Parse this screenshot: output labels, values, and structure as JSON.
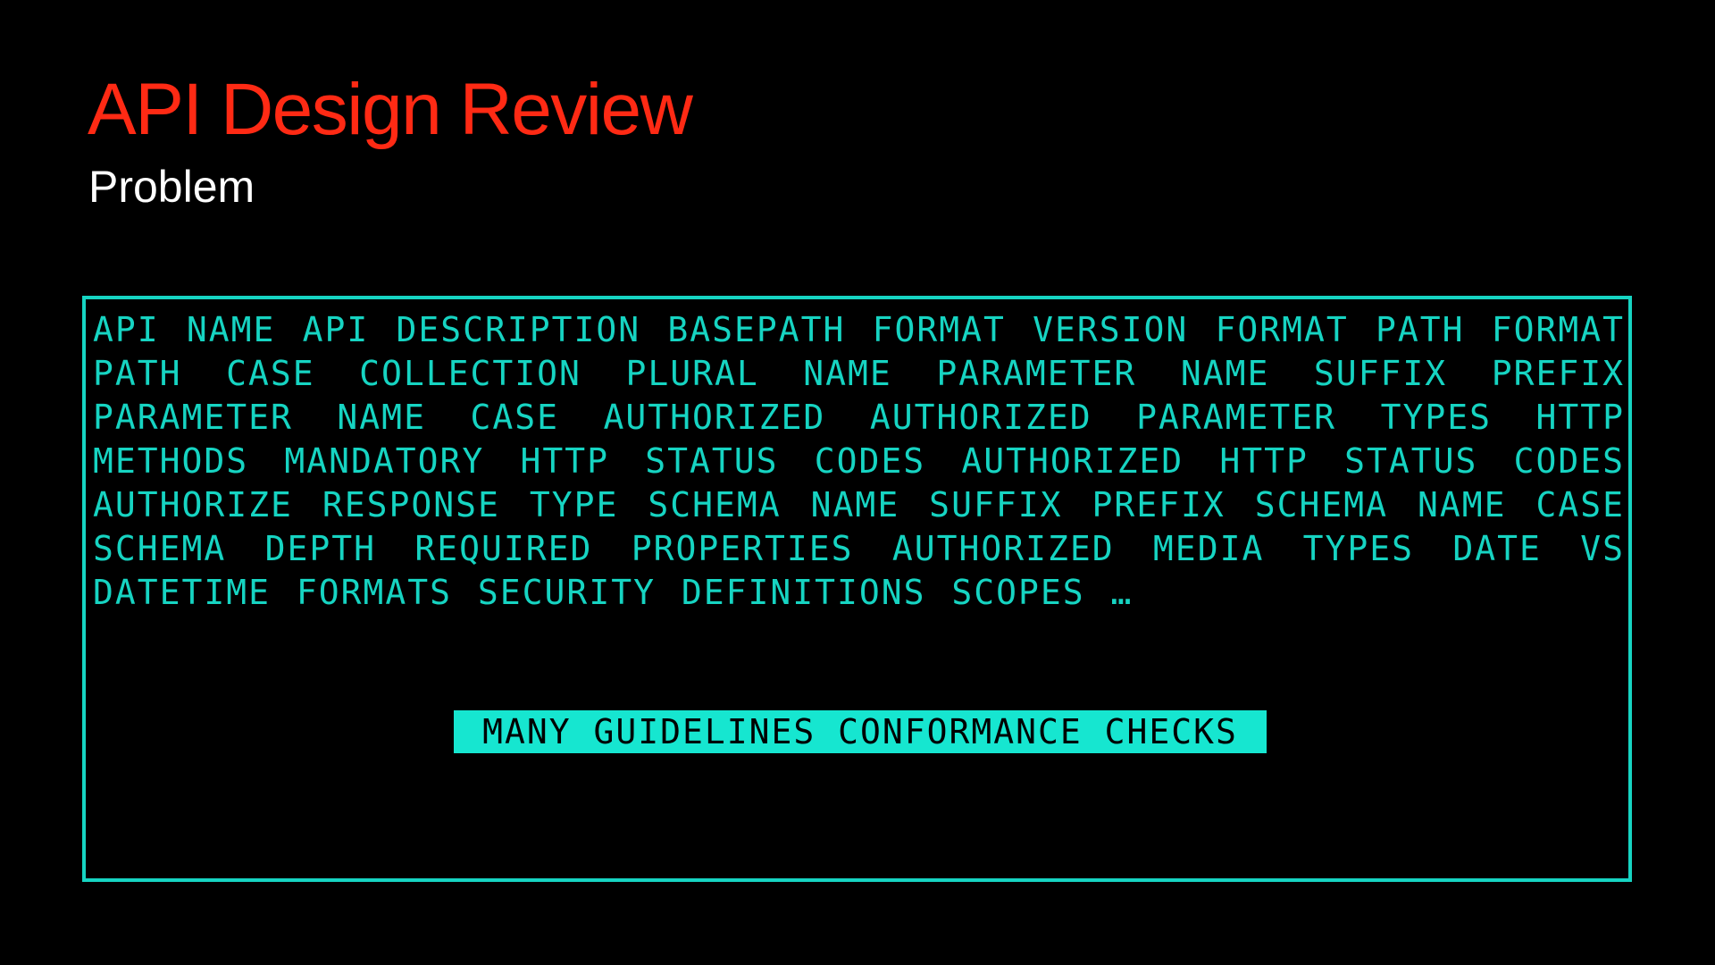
{
  "slide": {
    "title": "API Design Review",
    "subtitle": "Problem"
  },
  "terminal": {
    "guidelines_text": "API NAME API DESCRIPTION BASEPATH FORMAT VERSION FORMAT PATH FORMAT PATH CASE COLLECTION PLURAL NAME PARAMETER NAME SUFFIX PREFIX PARAMETER NAME CASE AUTHORIZED AUTHORIZED PARAMETER TYPES HTTP METHODS MANDATORY HTTP STATUS CODES AUTHORIZED HTTP STATUS CODES AUTHORIZE RESPONSE TYPE SCHEMA NAME SUFFIX PREFIX SCHEMA NAME CASE SCHEMA DEPTH REQUIRED PROPERTIES AUTHORIZED MEDIA TYPES DATE VS DATETIME FORMATS SECURITY DEFINITIONS SCOPES …",
    "highlight_text": "MANY GUIDELINES CONFORMANCE CHECKS"
  },
  "colors": {
    "background": "#000000",
    "title": "#ff2a14",
    "subtitle": "#ffffff",
    "terminal_accent": "#16d4c2",
    "highlight_background": "#16e6d0",
    "highlight_text": "#000000"
  }
}
